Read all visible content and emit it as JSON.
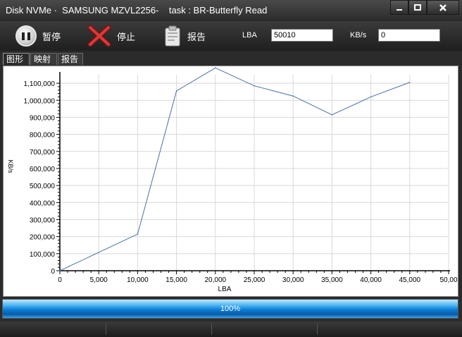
{
  "window": {
    "title": "Disk NVMe ·  SAMSUNG MZVL2256-    task : BR-Butterfly Read"
  },
  "toolbar": {
    "pause_label": "暂停",
    "stop_label": "停止",
    "report_label": "报告",
    "lba_label": "LBA",
    "lba_value": "50010",
    "kbs_label": "KB/s",
    "kbs_value": "0"
  },
  "tabs": [
    {
      "label": "图形",
      "active": true
    },
    {
      "label": "映射",
      "active": false
    },
    {
      "label": "报告",
      "active": false
    }
  ],
  "chart_data": {
    "type": "line",
    "xlabel": "LBA",
    "ylabel": "KB/s",
    "xlim": [
      0,
      50000
    ],
    "ylim": [
      0,
      1150000
    ],
    "grid": true,
    "x_ticks": [
      0,
      5000,
      10000,
      15000,
      20000,
      25000,
      30000,
      35000,
      40000,
      45000,
      50000
    ],
    "x_tick_labels": [
      "0",
      "5,000",
      "10,000",
      "15,000",
      "20,000",
      "25,000",
      "30,000",
      "35,000",
      "40,000",
      "45,000",
      "50,00"
    ],
    "y_ticks": [
      0,
      100000,
      200000,
      300000,
      400000,
      500000,
      600000,
      700000,
      800000,
      900000,
      1000000,
      1100000
    ],
    "y_tick_labels": [
      "0",
      "100,000",
      "200,000",
      "300,000",
      "400,000",
      "500,000",
      "600,000",
      "700,000",
      "800,000",
      "900,000",
      "1,000,000",
      "1,100,000"
    ],
    "series": [
      {
        "color": "#4a6fa8",
        "x": [
          0,
          10000,
          15000,
          20000,
          25000,
          30000,
          35000,
          40000,
          45000
        ],
        "y": [
          0,
          215000,
          1055000,
          1190000,
          1085000,
          1025000,
          915000,
          1020000,
          1105000
        ]
      }
    ]
  },
  "progress": {
    "value": 1.0,
    "label": "100%"
  }
}
